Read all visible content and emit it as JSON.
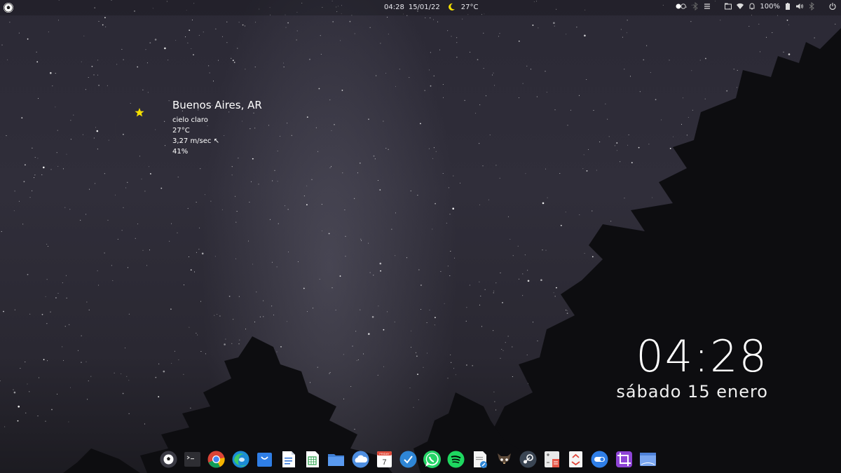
{
  "panel": {
    "time": "04:28",
    "date": "15/01/22",
    "temperature": "27°C",
    "battery": "100%",
    "icons": [
      "app-menu-icon",
      "moon-icon",
      "toggle-icon",
      "bluetooth-icon",
      "menu-lines-icon",
      "folder-icon",
      "wifi-icon",
      "bell-icon",
      "battery-icon",
      "volume-icon",
      "bluetooth-icon",
      "power-icon"
    ]
  },
  "weather": {
    "city": "Buenos Aires, AR",
    "condition": "cielo claro",
    "temperature": "27°C",
    "wind": "3,27 m/sec ↖",
    "humidity": "41%",
    "icon": "moon-star-icon",
    "icon_color": "#f5e000"
  },
  "clock": {
    "time": "04:28",
    "date": "sábado 15 enero"
  },
  "calendar_icon": {
    "weekday": "FRIDAY",
    "day": "7"
  },
  "dock": {
    "apps": [
      "soccer-ball-icon",
      "terminal-icon",
      "chrome-icon",
      "edge-icon",
      "store-icon",
      "writer-icon",
      "calc-spreadsheet-icon",
      "files-icon",
      "cloud-icon",
      "calendar-icon",
      "tasks-icon",
      "whatsapp-icon",
      "spotify-icon",
      "text-editor-icon",
      "gimp-icon",
      "steam-icon",
      "calculator-icon",
      "trash-icon",
      "toggle-app-icon",
      "crop-icon",
      "screenshot-icon"
    ]
  },
  "colors": {
    "sky_top": "#2b2935",
    "sky_bottom": "#1c1b21",
    "accent_yellow": "#f5e000"
  }
}
